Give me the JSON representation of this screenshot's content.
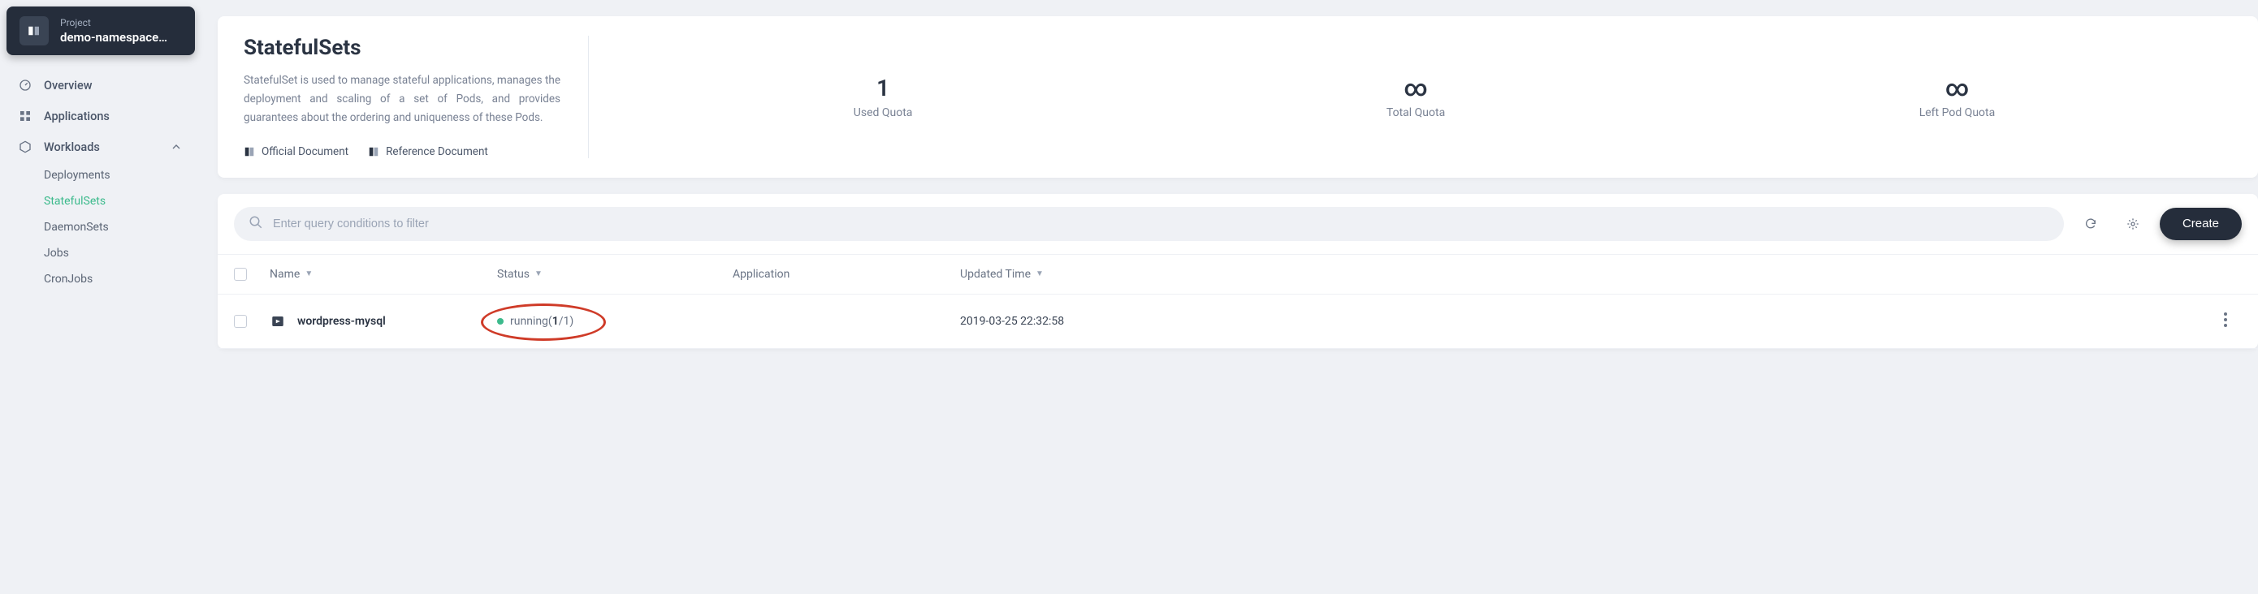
{
  "project": {
    "label": "Project",
    "name": "demo-namespace…"
  },
  "nav": {
    "overview": "Overview",
    "applications": "Applications",
    "workloads": {
      "label": "Workloads",
      "children": {
        "deployments": "Deployments",
        "statefulsets": "StatefulSets",
        "daemonsets": "DaemonSets",
        "jobs": "Jobs",
        "cronjobs": "CronJobs"
      }
    }
  },
  "page": {
    "title": "StatefulSets",
    "description": "StatefulSet is used to manage stateful applications, manages the deployment and scaling of a set of Pods, and provides guarantees about the ordering and uniqueness of these Pods.",
    "doc_links": {
      "official": "Official Document",
      "reference": "Reference Document"
    }
  },
  "quotas": {
    "used": {
      "value": "1",
      "label": "Used Quota"
    },
    "total": {
      "value": "∞",
      "label": "Total Quota"
    },
    "left": {
      "value": "∞",
      "label": "Left Pod Quota"
    }
  },
  "toolbar": {
    "search_placeholder": "Enter query conditions to filter",
    "create_label": "Create"
  },
  "table": {
    "columns": {
      "name": "Name",
      "status": "Status",
      "application": "Application",
      "updated": "Updated Time"
    },
    "rows": [
      {
        "name": "wordpress-mysql",
        "status_label": "running",
        "status_ready": "1",
        "status_total": "/1",
        "status_open": "(",
        "status_close": ")",
        "application": "",
        "updated": "2019-03-25 22:32:58"
      }
    ]
  }
}
